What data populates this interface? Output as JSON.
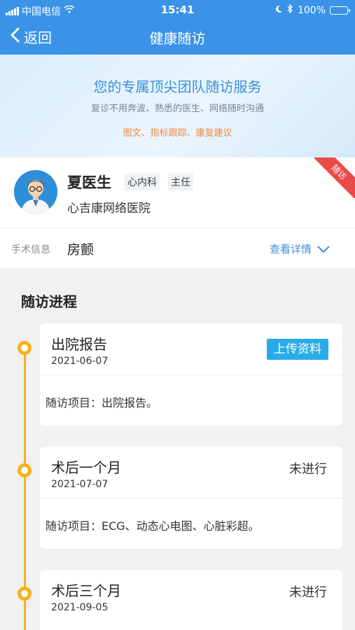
{
  "status_bar": {
    "carrier": "中国电信",
    "time": "15:41",
    "battery": "100%"
  },
  "nav": {
    "back_label": "返回",
    "title": "健康随访"
  },
  "banner": {
    "title": "您的专属顶尖团队随访服务",
    "subtitle": "复诊不用奔波、熟悉的医生、网络随时沟通",
    "tags": "图文、指标跟踪、康复建议"
  },
  "doctor": {
    "name": "夏医生",
    "department": "心内科",
    "title": "主任",
    "hospital": "心吉康网络医院",
    "ribbon": "随访"
  },
  "surgery": {
    "label": "手术信息",
    "value": "房颤",
    "detail_label": "查看详情"
  },
  "timeline": {
    "section_title": "随访进程",
    "items": [
      {
        "title": "出院报告",
        "date": "2021-06-07",
        "action": "上传资料",
        "status": "",
        "item_text": "随访项目：出院报告。"
      },
      {
        "title": "术后一个月",
        "date": "2021-07-07",
        "action": "",
        "status": "未进行",
        "item_text": "随访项目：ECG、动态心电图、心脏彩超。"
      },
      {
        "title": "术后三个月",
        "date": "2021-09-05",
        "action": "",
        "status": "未进行",
        "item_text": ""
      }
    ]
  },
  "colors": {
    "primary": "#3b93e8",
    "timeline": "#f5b21a",
    "upload": "#2aabe9",
    "ribbon": "#ec4a4a",
    "tags": "#f08a3a"
  }
}
